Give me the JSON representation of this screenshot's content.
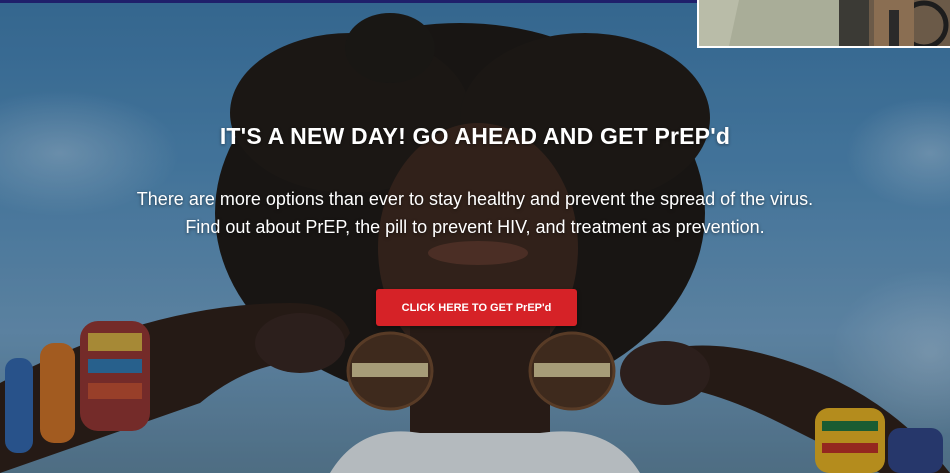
{
  "hero": {
    "headline": "IT'S A NEW DAY! GO AHEAD AND GET PrEP'd",
    "description_line1": "There are more options than ever to stay healthy and prevent the spread of the virus.",
    "description_line2": "Find out about PrEP, the pill to prevent HIV, and treatment as prevention.",
    "cta_label": "CLICK HERE TO GET PrEP'd"
  },
  "colors": {
    "cta_background": "#d62227",
    "top_bar": "#1f1f6b",
    "text": "#ffffff"
  }
}
